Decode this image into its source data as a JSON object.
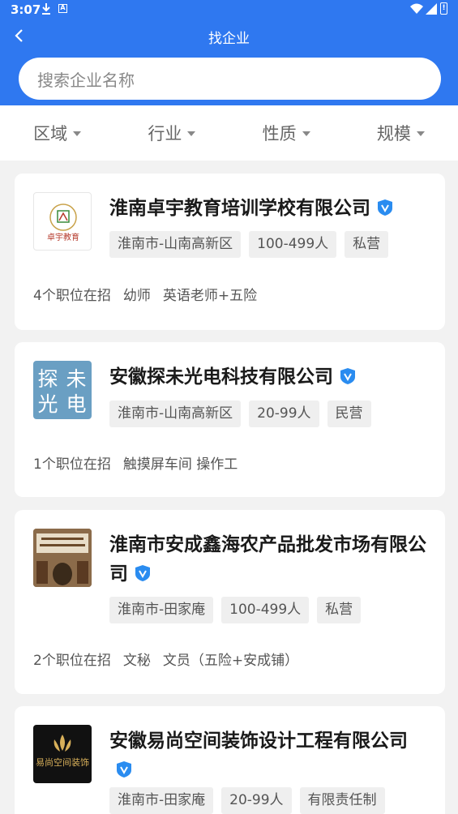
{
  "status_bar": {
    "time": "3:07",
    "a_label": "A",
    "battery_label": "!"
  },
  "header": {
    "title": "找企业"
  },
  "search": {
    "placeholder": "搜索企业名称"
  },
  "filters": [
    {
      "label": "区域"
    },
    {
      "label": "行业"
    },
    {
      "label": "性质"
    },
    {
      "label": "规模"
    }
  ],
  "companies": [
    {
      "name": "淮南卓宇教育培训学校有限公司",
      "logo_text": "卓宇教育",
      "tags": [
        "淮南市-山南高新区",
        "100-499人",
        "私营"
      ],
      "job_count": "4个职位在招",
      "jobs": [
        "幼师",
        "英语老师+五险"
      ]
    },
    {
      "name": "安徽探未光电科技有限公司",
      "logo_chars": [
        "探",
        "未",
        "光",
        "电"
      ],
      "tags": [
        "淮南市-山南高新区",
        "20-99人",
        "民营"
      ],
      "job_count": "1个职位在招",
      "jobs": [
        "触摸屏车间 操作工"
      ]
    },
    {
      "name": "淮南市安成鑫海农产品批发市场有限公司",
      "tags": [
        "淮南市-田家庵",
        "100-499人",
        "私营"
      ],
      "job_count": "2个职位在招",
      "jobs": [
        "文秘",
        "文员（五险+安成铺）"
      ]
    },
    {
      "name": "安徽易尚空间装饰设计工程有限公司",
      "logo_text": "易尚空间装饰",
      "tags": [
        "淮南市-田家庵",
        "20-99人",
        "有限责任制"
      ]
    }
  ],
  "colors": {
    "header_blue": "#2f78f0",
    "verify_blue": "#2a8cf0",
    "tag_bg": "#efefef"
  }
}
